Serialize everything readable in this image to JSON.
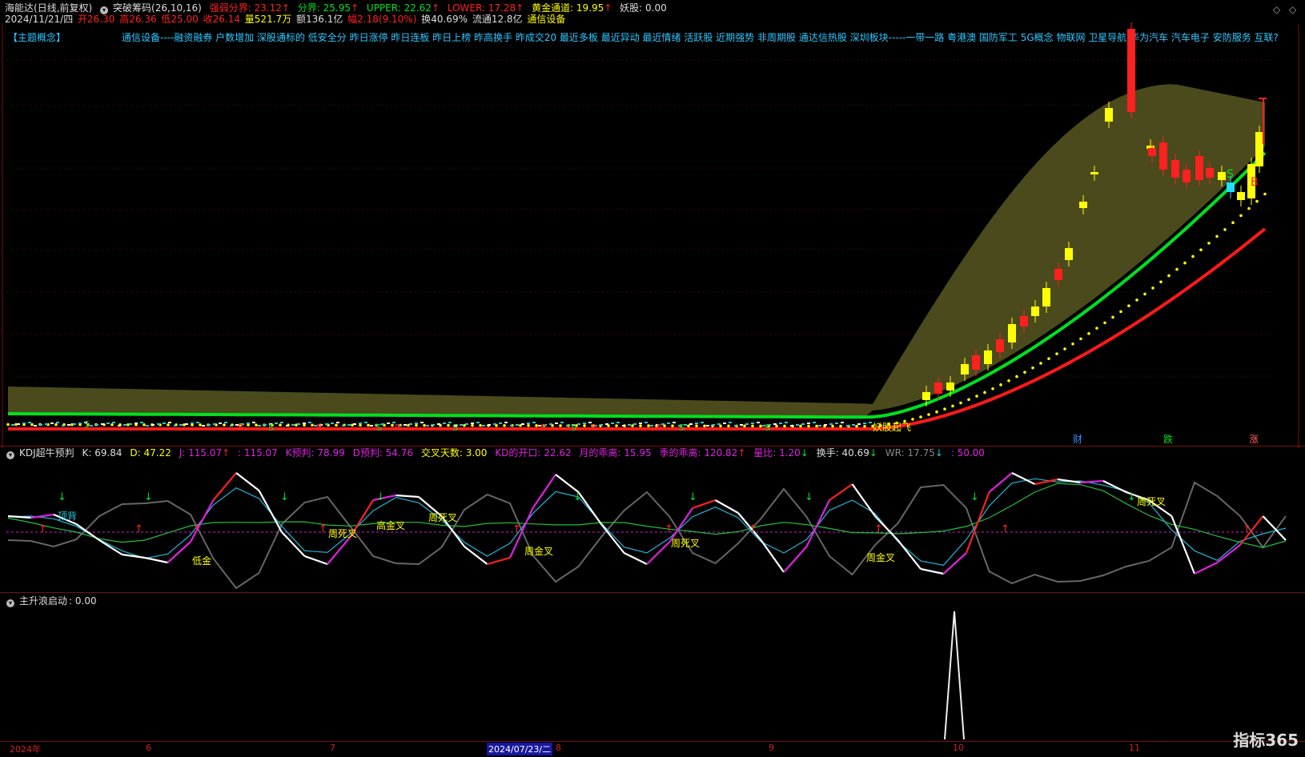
{
  "header": {
    "line1": {
      "stock": "海能达",
      "period": "(日线,前复权)",
      "indicator": "突破筹码",
      "params": "(26,10,16)",
      "strong_weak": "强弱分界: 23.12",
      "fenjie": "分界: 25.95",
      "upper": "UPPER: 22.62",
      "lower": "LOWER: 17.28",
      "golden": "黄金通道: 19.95",
      "yao": "妖股: 0.00"
    },
    "line2": {
      "date": "2024/11/21/四",
      "open": "开26.30",
      "high": "高26.36",
      "low": "低25.00",
      "close": "收26.14",
      "volume": "量521.7万",
      "amount": "额136.1亿",
      "change": "幅2.18(9.10%)",
      "turnover": "换40.69%",
      "float": "流通12.8亿",
      "sector": "通信设备"
    },
    "concept_label": "【主题概念】",
    "concept_text": "通信设备----融资融券 户数增加 深股通标的 低安全分 昨日涨停 昨日连板 昨日上榜 昨高换手 昨成交20 最近多板 最近异动 最近情绪 活跃股 近期强势 非周期股 通达信热股 深圳板块-----一带一路 粤港澳 国防军工 5G概念 物联网 卫星导航 华为汽车 汽车电子 安防服务 互联?"
  },
  "main_labels": {
    "s": "S",
    "b": "B",
    "yao_start": "妖股起飞",
    "cai": "财",
    "die": "跌",
    "zhang": "涨"
  },
  "kdj": {
    "title": "KDJ超牛预判",
    "k": "K: 69.84",
    "d": "D: 47.22",
    "j": "J: 115.07",
    "j2": ": 115.07",
    "kpred": "K预判: 78.99",
    "dpred": "D预判: 54.76",
    "cross": "交叉天数: 3.00",
    "kd_open": "KD的开口: 22.62",
    "month": "月的乖离: 15.95",
    "quarter": "季的乖离: 120.82",
    "vol_ratio": "量比: 1.20",
    "turnover": "换手: 40.69",
    "wr": "WR: 17.75",
    "fifty": ": 50.00",
    "labels": {
      "top_div": "顶背",
      "di_jin": "低金",
      "week_dead": "周死叉",
      "high_gold": "高金叉",
      "week_gold": "周金叉"
    }
  },
  "bottom": {
    "title": "主升浪启动",
    "value": ": 0.00"
  },
  "xaxis": {
    "year": "2024年",
    "m6": "6",
    "m7": "7",
    "date_cursor": "2024/07/23/二",
    "m8": "8",
    "m9": "9",
    "m10": "10",
    "m11": "11"
  },
  "logo": "指标365",
  "colors": {
    "up": "#ff2020",
    "yellow": "#ffff00",
    "green": "#00e020",
    "olive": "#4a4a1c",
    "cyan": "#20c8e0",
    "magenta": "#e020e0"
  }
}
